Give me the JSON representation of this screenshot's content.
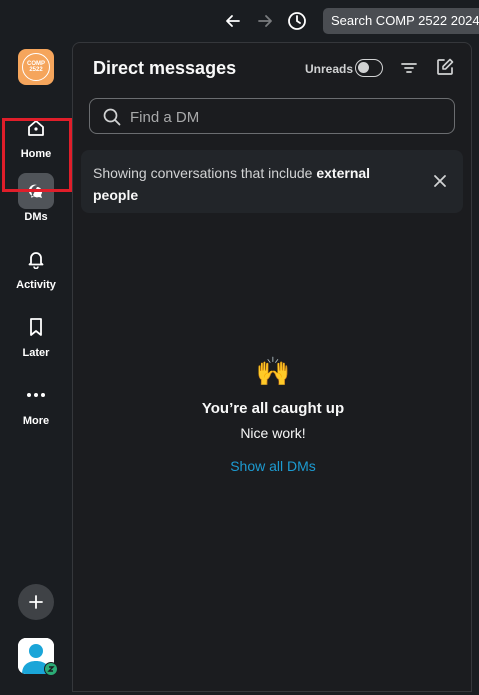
{
  "topbar": {
    "back_icon": "arrow-left-icon",
    "forward_icon": "arrow-right-icon",
    "history_icon": "clock-icon",
    "search_label": "Search COMP 2522 2024"
  },
  "workspace": {
    "line1": "COMP",
    "line2": "2522",
    "color": "#f5a55c"
  },
  "sidebar": {
    "items": [
      {
        "label": "Home",
        "icon": "home-icon"
      },
      {
        "label": "DMs",
        "icon": "chat-bubbles-icon",
        "active": true
      },
      {
        "label": "Activity",
        "icon": "bell-icon"
      },
      {
        "label": "Later",
        "icon": "bookmark-icon"
      },
      {
        "label": "More",
        "icon": "more-dots-icon"
      }
    ],
    "add_icon": "plus-icon"
  },
  "panel": {
    "title": "Direct messages",
    "unreads_label": "Unreads",
    "unreads_on": false,
    "find_placeholder": "Find a DM",
    "banner": {
      "text": "Showing conversations that include ",
      "bold": "external people"
    },
    "empty_state": {
      "emoji": "🙌",
      "heading": "You’re all caught up",
      "subtext": "Nice work!",
      "link": "Show all DMs"
    }
  },
  "colors": {
    "background": "#1a1d21",
    "accent_link": "#1d9bd1",
    "highlight": "#e01e2a",
    "status_green": "#2bac76"
  }
}
